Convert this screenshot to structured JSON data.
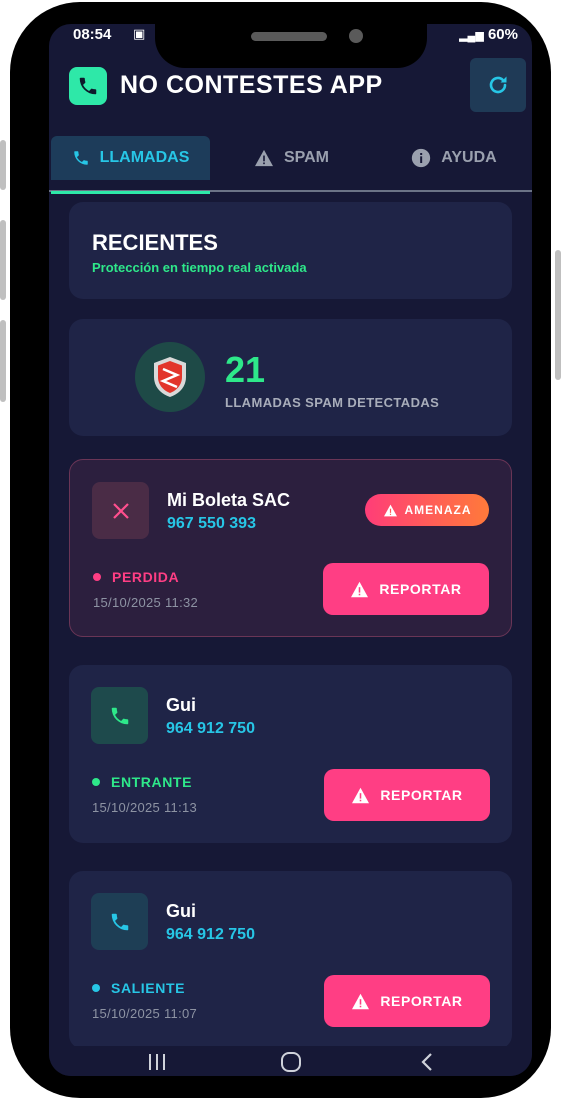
{
  "status_bar": {
    "time": "08:54",
    "battery": "60%"
  },
  "header": {
    "title": "NO CONTESTES APP"
  },
  "tabs": [
    {
      "label": "LLAMADAS",
      "active": true
    },
    {
      "label": "SPAM",
      "active": false
    },
    {
      "label": "AYUDA",
      "active": false
    }
  ],
  "recents": {
    "title": "RECIENTES",
    "subtitle": "Protección en tiempo real activada"
  },
  "stats": {
    "count": "21",
    "label": "LLAMADAS SPAM DETECTADAS"
  },
  "calls": [
    {
      "name": "Mi Boleta SAC",
      "number": "967 550 393",
      "status": "PERDIDA",
      "datetime": "15/10/2025 11:32",
      "badge": "AMENAZA",
      "report_label": "REPORTAR",
      "status_color": "#ff3e84"
    },
    {
      "name": "Gui",
      "number": "964 912 750",
      "status": "ENTRANTE",
      "datetime": "15/10/2025 11:13",
      "report_label": "REPORTAR",
      "status_color": "#2ee88a"
    },
    {
      "name": "Gui",
      "number": "964 912 750",
      "status": "SALIENTE",
      "datetime": "15/10/2025 11:07",
      "report_label": "REPORTAR",
      "status_color": "#27c6e6"
    }
  ],
  "colors": {
    "accent": "#2ee8a8",
    "primary_blue": "#27c6e6",
    "danger": "#ff3e84",
    "background": "#161836",
    "card": "#1f2447"
  }
}
